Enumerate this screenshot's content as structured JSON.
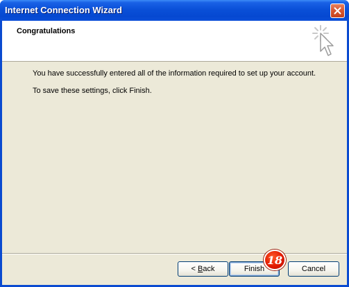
{
  "window": {
    "title": "Internet Connection Wizard",
    "close_icon": "close-x-icon"
  },
  "header": {
    "title": "Congratulations",
    "icon": "wizard-sparkle-cursor-icon"
  },
  "body": {
    "line1": "You have successfully entered all of the information required to set up your account.",
    "line2": "To save these settings, click Finish."
  },
  "buttons": {
    "back_prefix": "< ",
    "back_mnemonic": "B",
    "back_rest": "ack",
    "finish": "Finish",
    "cancel": "Cancel"
  },
  "annotation": {
    "step_number": "18"
  },
  "colors": {
    "titlebar": "#0a50d8",
    "client_bg": "#ece9d8",
    "close_button": "#d6552f",
    "badge": "#e21a00"
  }
}
